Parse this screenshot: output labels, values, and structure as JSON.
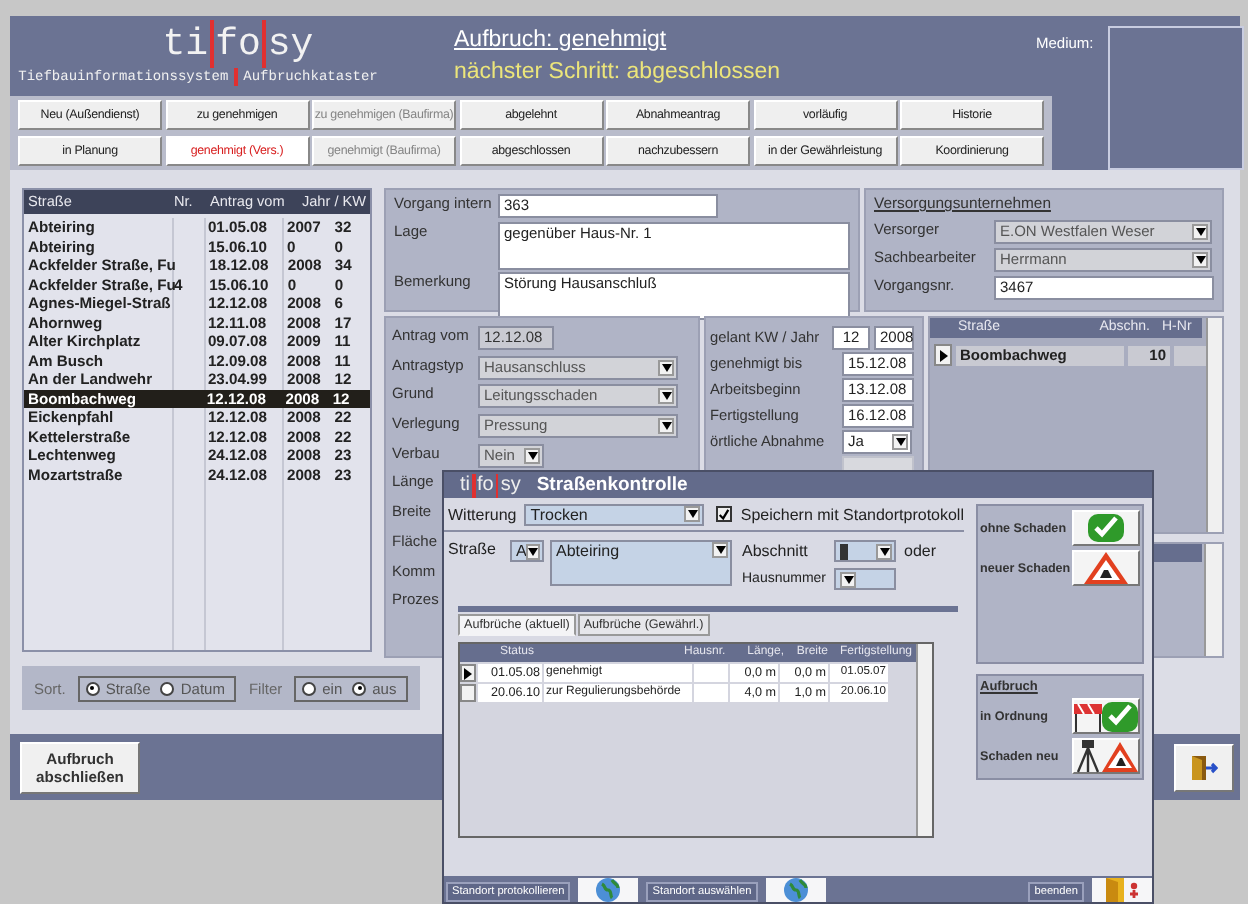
{
  "app": {
    "logo": [
      "ti",
      "fo",
      "sy"
    ],
    "subtitle": [
      "Tiefbauinformationssystem",
      "Aufbruchkataster"
    ]
  },
  "header": {
    "status": "Aufbruch: genehmigt",
    "next_step": "nächster Schritt: abgeschlossen",
    "medium_label": "Medium:"
  },
  "status_buttons": [
    [
      {
        "label": "Neu (Außendienst)",
        "selected": false,
        "disabled": false
      },
      {
        "label": "zu genehmigen",
        "selected": false,
        "disabled": false
      },
      {
        "label": "zu genehmigen (Baufirma)",
        "selected": false,
        "disabled": true
      },
      {
        "label": "abgelehnt",
        "selected": false,
        "disabled": false
      },
      {
        "label": "Abnahmeantrag",
        "selected": false,
        "disabled": false
      },
      {
        "label": "vorläufig",
        "selected": false,
        "disabled": false
      },
      {
        "label": "Historie",
        "selected": false,
        "disabled": false
      }
    ],
    [
      {
        "label": "in Planung",
        "selected": false,
        "disabled": false
      },
      {
        "label": "genehmigt (Vers.)",
        "selected": true,
        "disabled": false
      },
      {
        "label": "genehmigt (Baufirma)",
        "selected": false,
        "disabled": true
      },
      {
        "label": "abgeschlossen",
        "selected": false,
        "disabled": false
      },
      {
        "label": "nachzubessern",
        "selected": false,
        "disabled": false
      },
      {
        "label": "in der Gewährleistung",
        "selected": false,
        "disabled": false
      },
      {
        "label": "Koordinierung",
        "selected": false,
        "disabled": false
      }
    ]
  ],
  "street_list": {
    "columns": [
      "Straße",
      "Nr.",
      "Antrag vom",
      "Jahr / KW"
    ],
    "rows": [
      {
        "street": "Abteiring",
        "date": "01.05.08",
        "year": "2007",
        "kw": "32",
        "selected": false
      },
      {
        "street": "Abteiring",
        "date": "15.06.10",
        "year": "0",
        "kw": "0",
        "selected": false
      },
      {
        "street": "Ackfelder Straße, Fu",
        "date": "18.12.08",
        "year": "2008",
        "kw": "34",
        "selected": false
      },
      {
        "street": "Ackfelder Straße, Fu",
        "nr": "4",
        "date": "15.06.10",
        "year": "0",
        "kw": "0",
        "selected": false
      },
      {
        "street": "Agnes-Miegel-Straß",
        "date": "12.12.08",
        "year": "2008",
        "kw": "6",
        "selected": false
      },
      {
        "street": "Ahornweg",
        "date": "12.11.08",
        "year": "2008",
        "kw": "17",
        "selected": false
      },
      {
        "street": "Alter Kirchplatz",
        "date": "09.07.08",
        "year": "2009",
        "kw": "11",
        "selected": false
      },
      {
        "street": "Am Busch",
        "date": "12.09.08",
        "year": "2008",
        "kw": "11",
        "selected": false
      },
      {
        "street": "An der Landwehr",
        "date": "23.04.99",
        "year": "2008",
        "kw": "12",
        "selected": false
      },
      {
        "street": "Boombachweg",
        "date": "12.12.08",
        "year": "2008",
        "kw": "12",
        "selected": true
      },
      {
        "street": "Eickenpfahl",
        "date": "12.12.08",
        "year": "2008",
        "kw": "22",
        "selected": false
      },
      {
        "street": "Kettelerstraße",
        "date": "12.12.08",
        "year": "2008",
        "kw": "22",
        "selected": false
      },
      {
        "street": "Lechtenweg",
        "date": "24.12.08",
        "year": "2008",
        "kw": "23",
        "selected": false
      },
      {
        "street": "Mozartstraße",
        "date": "24.12.08",
        "year": "2008",
        "kw": "23",
        "selected": false
      }
    ]
  },
  "vorgang": {
    "fields": [
      {
        "label": "Vorgang intern",
        "value": "363",
        "kind": "input"
      },
      {
        "label": "Lage",
        "value": "gegenüber Haus-Nr. 1",
        "kind": "memo"
      },
      {
        "label": "Bemerkung",
        "value": "Störung Hausanschluß",
        "kind": "memo"
      }
    ]
  },
  "versorgung": {
    "title": "Versorgungsunternehmen",
    "fields": [
      {
        "label": "Versorger",
        "value": "E.ON Westfalen Weser",
        "kind": "select"
      },
      {
        "label": "Sachbearbeiter",
        "value": "Herrmann",
        "kind": "select"
      },
      {
        "label": "Vorgangsnr.",
        "value": "3467",
        "kind": "input"
      }
    ]
  },
  "antrag": {
    "fields": [
      {
        "label": "Antrag vom",
        "value": "12.12.08",
        "kind": "readonly"
      },
      {
        "label": "Antragstyp",
        "value": "Hausanschluss",
        "kind": "select"
      },
      {
        "label": "Grund",
        "value": "Leitungsschaden",
        "kind": "select"
      },
      {
        "label": "Verlegung",
        "value": "Pressung",
        "kind": "select"
      },
      {
        "label": "Verbau",
        "value": "Nein",
        "kind": "small-select"
      },
      {
        "label": "Länge",
        "kind": "label"
      },
      {
        "label": "Breite",
        "kind": "label"
      },
      {
        "label": "Fläche",
        "kind": "label"
      },
      {
        "label": "Komm",
        "kind": "label"
      },
      {
        "label": "Prozes",
        "kind": "label"
      }
    ]
  },
  "termine": [
    {
      "label": "gelant  KW / Jahr",
      "values": [
        "12",
        "2008"
      ],
      "kind": "input"
    },
    {
      "label": "genehmigt bis",
      "values": [
        "15.12.08"
      ],
      "kind": "input"
    },
    {
      "label": "Arbeitsbeginn",
      "values": [
        "13.12.08"
      ],
      "kind": "input"
    },
    {
      "label": "Fertigstellung",
      "values": [
        "16.12.08"
      ],
      "kind": "input"
    },
    {
      "label": "örtliche Abnahme",
      "values": [
        "Ja"
      ],
      "kind": "select"
    }
  ],
  "sections": {
    "columns": [
      "Straße",
      "Abschn.",
      "H-Nr"
    ],
    "rows": [
      {
        "street": "Boombachweg",
        "section": "10",
        "selected": true
      }
    ]
  },
  "sort": {
    "label": "Sort.",
    "options": [
      {
        "label": "Straße",
        "selected": true
      },
      {
        "label": "Datum",
        "selected": false
      }
    ]
  },
  "filter": {
    "label": "Filter",
    "options": [
      {
        "label": "ein",
        "selected": false
      },
      {
        "label": "aus",
        "selected": true
      }
    ]
  },
  "close_button": "Aufbruch abschließen",
  "dialog": {
    "logo": [
      "ti",
      "fo",
      "sy"
    ],
    "title": "Straßenkontrolle",
    "weather_label": "Witterung",
    "weather": "Trocken",
    "save_protocol": {
      "label": "Speichern mit Standortprotokoll",
      "checked": true
    },
    "street_label": "Straße",
    "street_letter": "A",
    "street": "Abteiring",
    "section_label": "Abschnitt",
    "or_label": "oder",
    "house_label": "Hausnummer",
    "damage_options": [
      "ohne Schaden",
      "neuer Schaden"
    ],
    "tabs": [
      {
        "label": "Aufbrüche (aktuell)",
        "selected": true
      },
      {
        "label": "Aufbrüche (Gewährl.)",
        "selected": false
      }
    ],
    "table": {
      "columns": [
        "Status",
        "Hausnr.",
        "Länge,",
        "Breite",
        "Fertigstellung"
      ],
      "rows": [
        {
          "date": "01.05.08",
          "status": "genehmigt",
          "length": "0,0 m",
          "width": "0,0 m",
          "completion": "01.05.07",
          "selected": true
        },
        {
          "date": "20.06.10",
          "status": "zur Regulierungsbehörde",
          "length": "4,0 m",
          "width": "1,0 m",
          "completion": "20.06.10",
          "selected": false
        }
      ]
    },
    "aufbruch": {
      "title": "Aufbruch",
      "options": [
        "in Ordnung",
        "Schaden neu"
      ]
    },
    "bottom_buttons": [
      "Standort protokollieren",
      "Standort auswählen",
      "beenden"
    ]
  }
}
